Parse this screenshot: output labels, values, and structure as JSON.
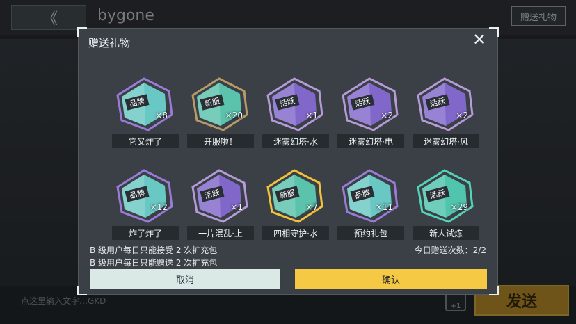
{
  "header": {
    "back_label": "《",
    "title": "bygone",
    "gift_button": "赠送礼物"
  },
  "chat": {
    "placeholder": "点这里输入文字…GKD",
    "emoji_hint": "+1",
    "send_label": "发送"
  },
  "modal": {
    "title": "赠送礼物",
    "close": "✕",
    "items": [
      {
        "name": "它又炸了",
        "count": "×8",
        "badge": "品牌",
        "color": "#6fd6d2",
        "frame": "#9b7bd8"
      },
      {
        "name": "开服啦！",
        "count": "×20",
        "badge": "新服",
        "color": "#5fd1b6",
        "frame": "#b69a6a"
      },
      {
        "name": "迷雾幻塔·水",
        "count": "×1",
        "badge": "活跃",
        "color": "#8b6cd8",
        "frame": "#b79ad8"
      },
      {
        "name": "迷雾幻塔·电",
        "count": "×2",
        "badge": "活跃",
        "color": "#8b6cd8",
        "frame": "#b79ad8"
      },
      {
        "name": "迷雾幻塔·风",
        "count": "×2",
        "badge": "活跃",
        "color": "#8b6cd8",
        "frame": "#b79ad8"
      },
      {
        "name": "炸了炸了",
        "count": "×12",
        "badge": "品牌",
        "color": "#6fd6d2",
        "frame": "#9b7bd8"
      },
      {
        "name": "一片混乱·上",
        "count": "×1",
        "badge": "活跃",
        "color": "#8b6cd8",
        "frame": "#b79ad8"
      },
      {
        "name": "四相守护·水",
        "count": "×7",
        "badge": "新服",
        "color": "#5fd1b6",
        "frame": "#f3c23c"
      },
      {
        "name": "预约礼包",
        "count": "×11",
        "badge": "品牌",
        "color": "#6fd6d2",
        "frame": "#9b7bd8"
      },
      {
        "name": "新人试炼",
        "count": "×29",
        "badge": "活跃",
        "color": "#53d3b8",
        "frame": "#53d3b8"
      }
    ],
    "rule_receive": "B 级用户每日只能接受 2 次扩充包",
    "rule_send": "B 级用户每日只能赠送 2 次扩充包",
    "daily_count": "今日赠送次数：2/2",
    "cancel_label": "取消",
    "confirm_label": "确认"
  }
}
